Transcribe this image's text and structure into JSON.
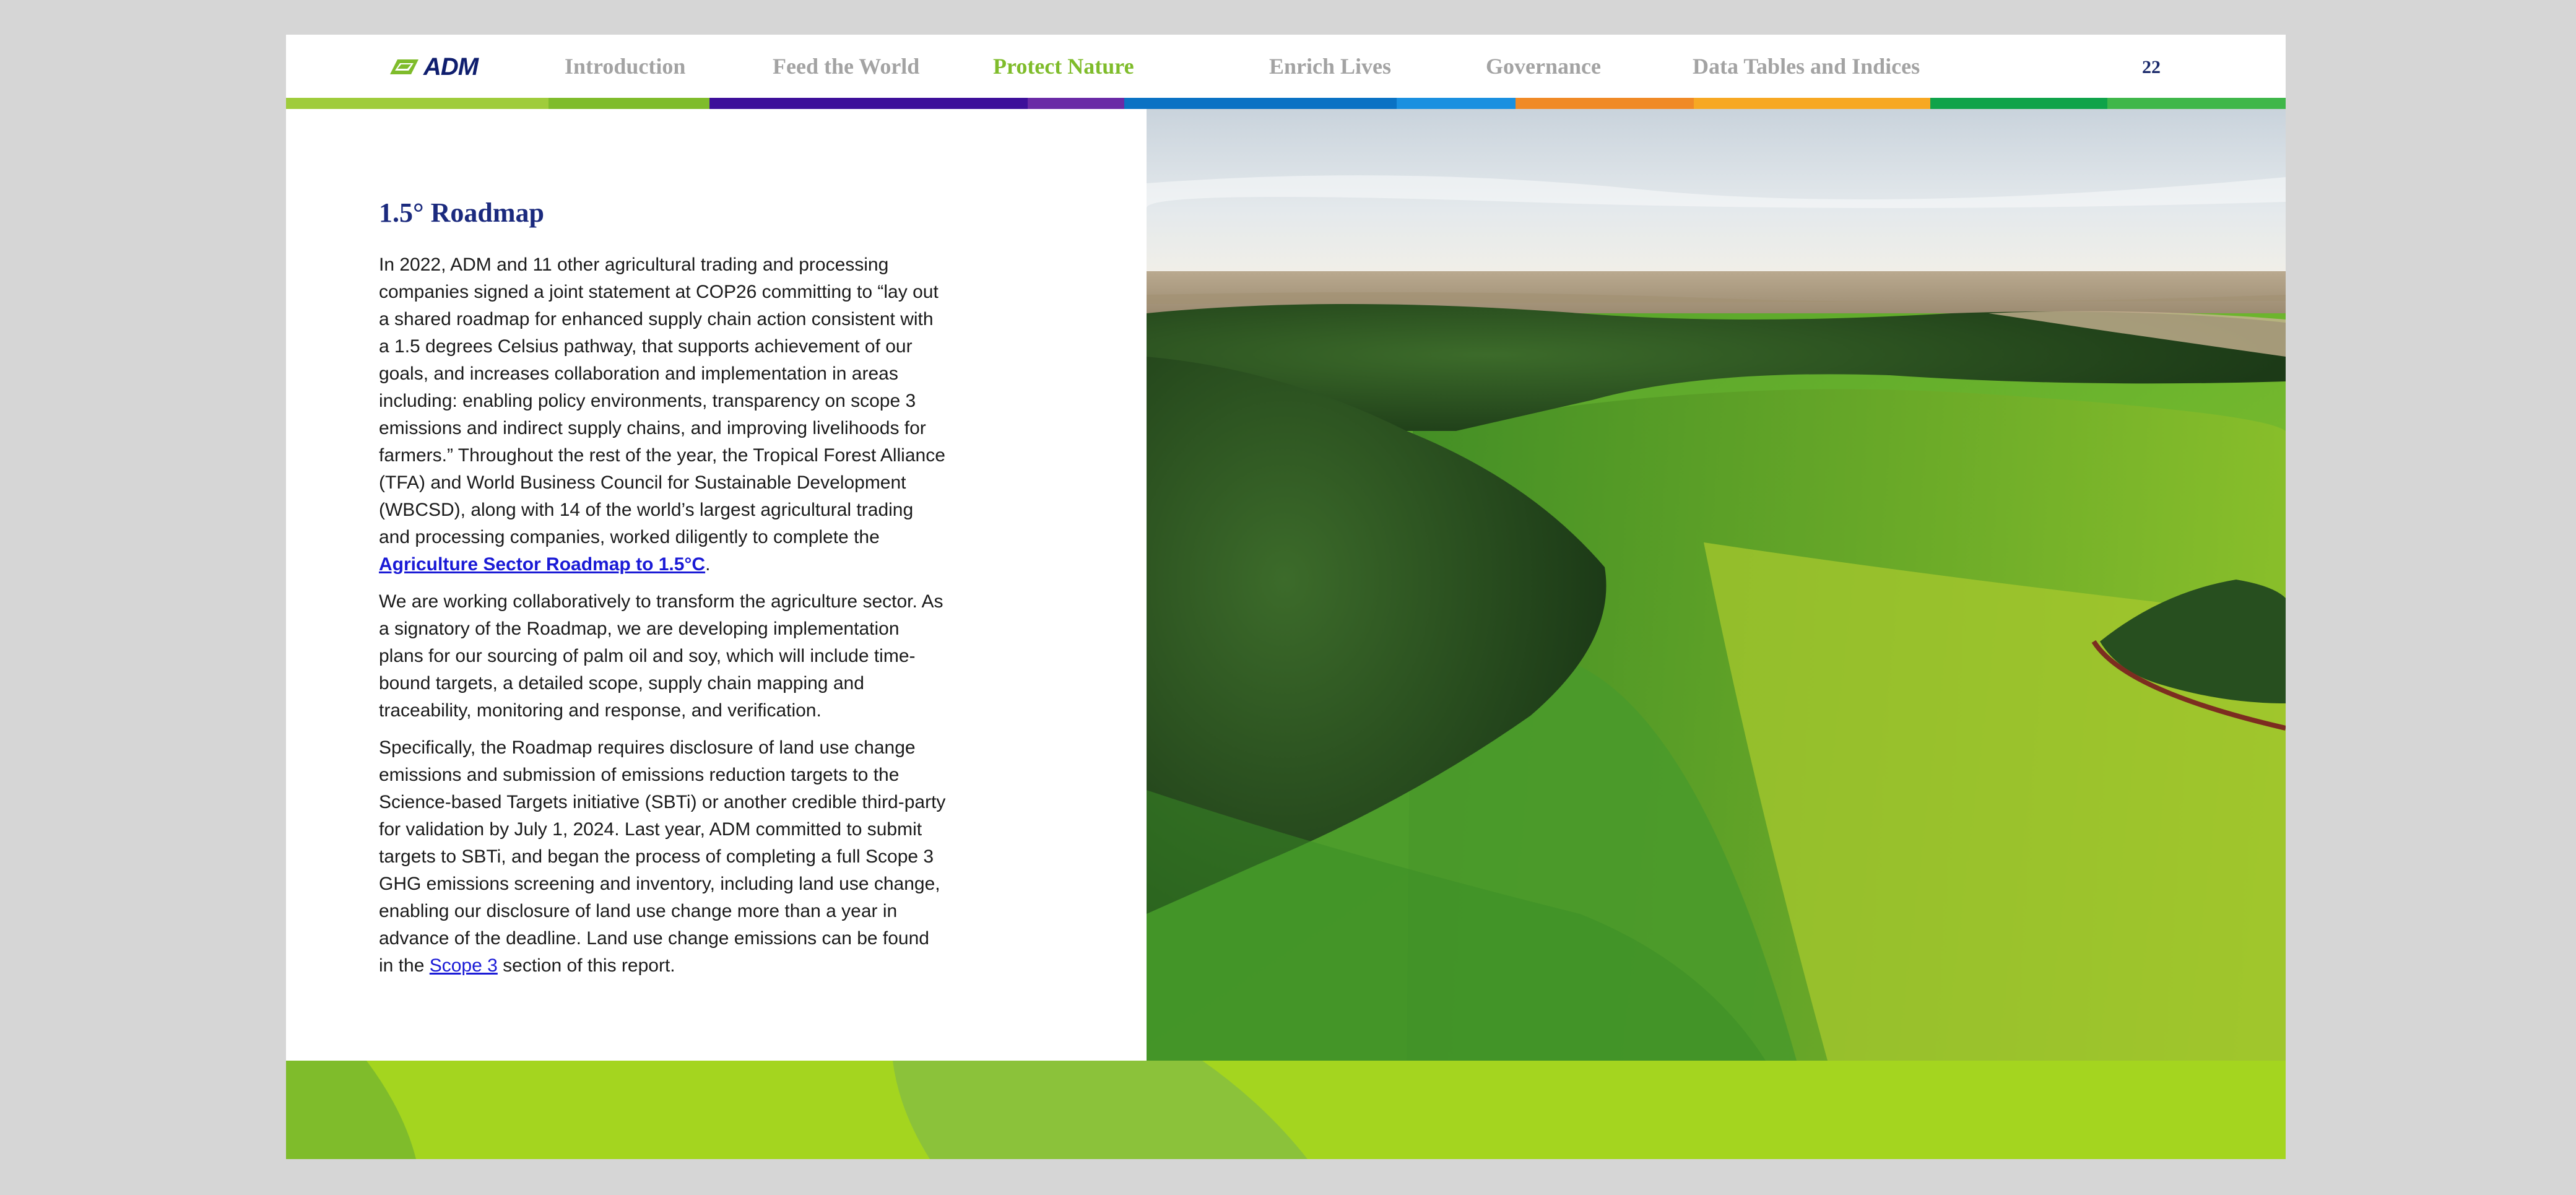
{
  "header": {
    "logo_text": "ADM",
    "nav": [
      {
        "label": "Introduction"
      },
      {
        "label": "Feed the World"
      },
      {
        "label": "Protect Nature",
        "active": true
      },
      {
        "label": "Enrich Lives"
      },
      {
        "label": "Governance"
      },
      {
        "label": "Data Tables and Indices"
      }
    ],
    "page_number": "22"
  },
  "colors": {
    "accent_green": "#7fbc2b",
    "title_blue": "#1b2a7e",
    "nav_gray": "#a3a3a3",
    "footer_lime": "#a4d51f"
  },
  "content": {
    "title": "1.5° Roadmap",
    "p1_text": "In 2022, ADM and 11 other agricultural trading and processing companies signed a joint statement at COP26 committing to “lay out a shared roadmap for enhanced supply chain action consistent with a 1.5 degrees Celsius pathway, that supports achievement of our goals, and increases collaboration and implementation in areas including: enabling policy environments, transparency on scope 3 emissions and indirect supply chains, and improving livelihoods for farmers.” Throughout the rest of the year, the Tropical Forest Alliance (TFA) and World Business Council for Sustainable Development (WBCSD), along with 14 of the world’s largest agricultural trading and processing companies, worked diligently to complete the ",
    "p1_link": "Agriculture Sector Roadmap to 1.5°C",
    "p1_end": ".",
    "p2": "We are working collaboratively to transform the agriculture sector. As a signatory of the Roadmap, we are developing implementation plans for our sourcing of palm oil and soy, which will include time-bound targets, a detailed scope, supply chain mapping and traceability, monitoring and response, and verification.",
    "p3_text": "Specifically, the Roadmap requires disclosure of land use change emissions and submission of emissions reduction targets to the Science-based Targets initiative (SBTi) or another credible third-party for validation by July 1, 2024. Last year, ADM committed to submit targets to SBTi, and began the process of completing a full Scope 3 GHG emissions screening and inventory, including land use change, enabling our disclosure of land use change more than a year in advance of the deadline. Land use change emissions can be found in the ",
    "p3_link": "Scope 3",
    "p3_end": " section of this report."
  }
}
